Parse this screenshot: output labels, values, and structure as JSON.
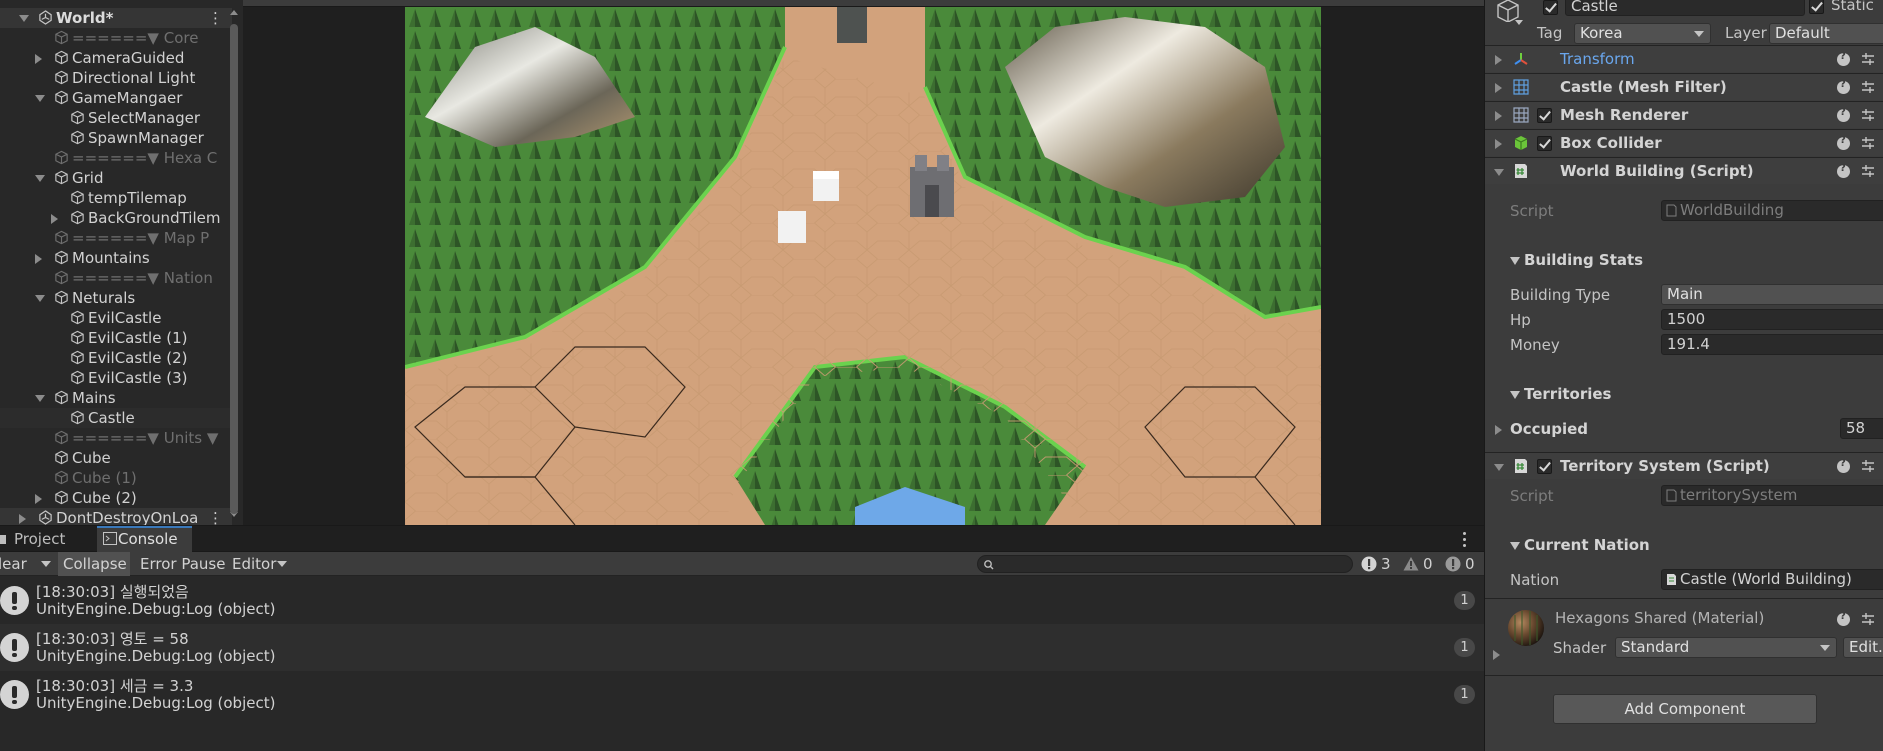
{
  "hierarchy": {
    "items": [
      {
        "label": "World*",
        "depth": 0,
        "arrow": "down",
        "icon": "unity-scene-icon",
        "kind": "scene",
        "menu": "⋮"
      },
      {
        "label": "======▼ Core",
        "depth": 1,
        "arrow": "",
        "icon": "gameobject-icon",
        "kind": "dim"
      },
      {
        "label": "CameraGuided",
        "depth": 1,
        "arrow": "right",
        "icon": "gameobject-icon",
        "kind": ""
      },
      {
        "label": "Directional Light",
        "depth": 1,
        "arrow": "",
        "icon": "gameobject-icon",
        "kind": ""
      },
      {
        "label": "GameMangaer",
        "depth": 1,
        "arrow": "down",
        "icon": "gameobject-icon",
        "kind": ""
      },
      {
        "label": "SelectManager",
        "depth": 2,
        "arrow": "",
        "icon": "gameobject-icon",
        "kind": ""
      },
      {
        "label": "SpawnManager",
        "depth": 2,
        "arrow": "",
        "icon": "gameobject-icon",
        "kind": ""
      },
      {
        "label": "======▼ Hexa C",
        "depth": 1,
        "arrow": "",
        "icon": "gameobject-icon",
        "kind": "dim"
      },
      {
        "label": "Grid",
        "depth": 1,
        "arrow": "down",
        "icon": "gameobject-icon",
        "kind": ""
      },
      {
        "label": "tempTilemap",
        "depth": 2,
        "arrow": "",
        "icon": "gameobject-icon",
        "kind": ""
      },
      {
        "label": "BackGroundTilem",
        "depth": 2,
        "arrow": "right",
        "icon": "gameobject-icon",
        "kind": ""
      },
      {
        "label": "======▼ Map P",
        "depth": 1,
        "arrow": "",
        "icon": "gameobject-icon",
        "kind": "dim"
      },
      {
        "label": "Mountains",
        "depth": 1,
        "arrow": "right",
        "icon": "gameobject-icon",
        "kind": ""
      },
      {
        "label": "======▼ Nation",
        "depth": 1,
        "arrow": "",
        "icon": "gameobject-icon",
        "kind": "dim"
      },
      {
        "label": "Neturals",
        "depth": 1,
        "arrow": "down",
        "icon": "gameobject-icon",
        "kind": ""
      },
      {
        "label": "EvilCastle",
        "depth": 2,
        "arrow": "",
        "icon": "gameobject-icon",
        "kind": ""
      },
      {
        "label": "EvilCastle (1)",
        "depth": 2,
        "arrow": "",
        "icon": "gameobject-icon",
        "kind": ""
      },
      {
        "label": "EvilCastle (2)",
        "depth": 2,
        "arrow": "",
        "icon": "gameobject-icon",
        "kind": ""
      },
      {
        "label": "EvilCastle (3)",
        "depth": 2,
        "arrow": "",
        "icon": "gameobject-icon",
        "kind": ""
      },
      {
        "label": "Mains",
        "depth": 1,
        "arrow": "down",
        "icon": "gameobject-icon",
        "kind": ""
      },
      {
        "label": "Castle",
        "depth": 2,
        "arrow": "",
        "icon": "gameobject-icon",
        "kind": "selected"
      },
      {
        "label": "======▼ Units ▼",
        "depth": 1,
        "arrow": "",
        "icon": "gameobject-icon",
        "kind": "dim"
      },
      {
        "label": "Cube",
        "depth": 1,
        "arrow": "",
        "icon": "gameobject-icon",
        "kind": ""
      },
      {
        "label": "Cube (1)",
        "depth": 1,
        "arrow": "",
        "icon": "gameobject-icon",
        "kind": "dim"
      },
      {
        "label": "Cube (2)",
        "depth": 1,
        "arrow": "right",
        "icon": "gameobject-icon",
        "kind": ""
      },
      {
        "label": "DontDestroyOnLoa",
        "depth": 0,
        "arrow": "right",
        "icon": "unity-scene-icon",
        "kind": "scene2",
        "menu": "⋮"
      }
    ]
  },
  "console": {
    "tabs": [
      {
        "label": "Project",
        "icon": "folder-icon"
      },
      {
        "label": "Console",
        "icon": "console-icon"
      }
    ],
    "toolbar": {
      "clear": "lear",
      "collapse": "Collapse",
      "error_pause": "Error Pause",
      "editor": "Editor",
      "search_placeholder": "",
      "info_count": "3",
      "warn_count": "0",
      "error_count": "0"
    },
    "logs": [
      {
        "line1": "[18:30:03] 실행되었음",
        "line2": "UnityEngine.Debug:Log (object)",
        "count": "1"
      },
      {
        "line1": "[18:30:03] 영토 = 58",
        "line2": "UnityEngine.Debug:Log (object)",
        "count": "1"
      },
      {
        "line1": "[18:30:03] 세금 = 3.3",
        "line2": "UnityEngine.Debug:Log (object)",
        "count": "1"
      }
    ]
  },
  "inspector": {
    "object_name": "Castle",
    "static_label": "Static",
    "tag_label": "Tag",
    "tag_value": "Korea",
    "layer_label": "Layer",
    "layer_value": "Default",
    "components": {
      "transform": "Transform",
      "mesh_filter": "Castle (Mesh Filter)",
      "mesh_renderer": "Mesh Renderer",
      "box_collider": "Box Collider",
      "world_building": "World Building (Script)",
      "territory_system": "Territory System (Script)"
    },
    "world_building": {
      "script_label": "Script",
      "script_value": "WorldBuilding",
      "building_stats": "Building Stats",
      "building_type_label": "Building Type",
      "building_type_value": "Main",
      "hp_label": "Hp",
      "hp_value": "1500",
      "money_label": "Money",
      "money_value": "191.4",
      "territories": "Territories",
      "occupied_label": "Occupied",
      "occupied_value": "58"
    },
    "territory_system": {
      "script_label": "Script",
      "script_value": "territorySystem",
      "current_nation": "Current Nation",
      "nation_label": "Nation",
      "nation_value": "Castle (World Building)"
    },
    "material": {
      "name": "Hexagons Shared (Material)",
      "shader_label": "Shader",
      "shader_value": "Standard",
      "edit_label": "Edit..."
    },
    "add_component": "Add Component"
  }
}
